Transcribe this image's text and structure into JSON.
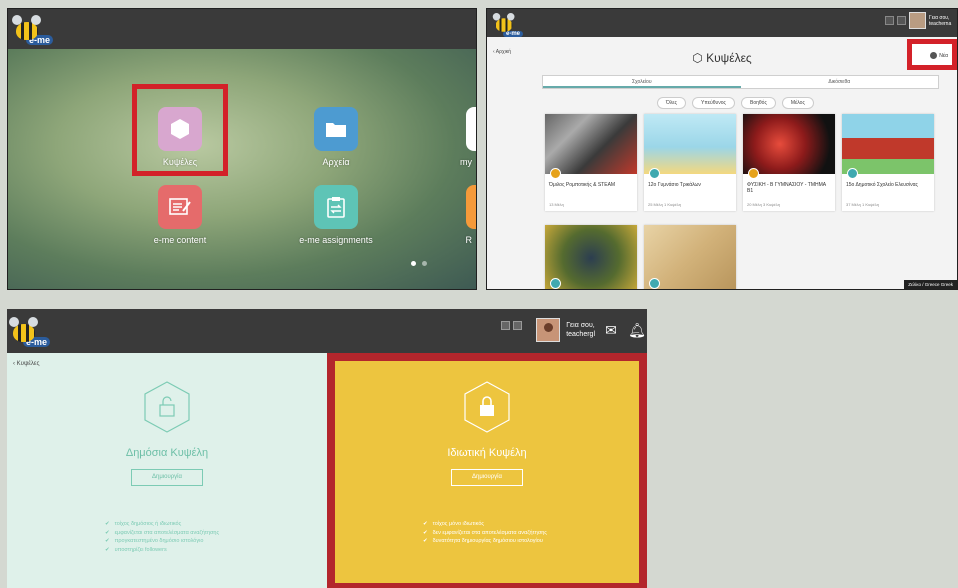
{
  "panel1": {
    "logo_text": "e-me",
    "apps": [
      {
        "label": "Κυψέλες",
        "icon": "hive-icon",
        "color": "#d8a7cf"
      },
      {
        "label": "Αρχεία",
        "icon": "folder-icon",
        "color": "#4d9bd1"
      },
      {
        "label": "my",
        "icon": "app-icon",
        "color": "#ffffff"
      },
      {
        "label": "e-me content",
        "icon": "content-editor-icon",
        "color": "#e56b6b"
      },
      {
        "label": "e-me assignments",
        "icon": "clipboard-icon",
        "color": "#5ec4b6"
      },
      {
        "label": "R",
        "icon": "app-icon",
        "color": "#f59a3a"
      }
    ]
  },
  "panel2": {
    "back_label": "Αρχική",
    "title": "Κυψέλες",
    "new_label": "Νέα",
    "tabs": [
      "Σχολείου",
      "Δικόσιεθα"
    ],
    "filters": [
      "Όλες",
      "Υπεύθυνος",
      "Βοηθός",
      "Μέλος"
    ],
    "cards": [
      {
        "title": "Όμιλος Ρομποτικής & STEAM",
        "meta": "13 Μέλη",
        "badge": "#e6a21b"
      },
      {
        "title": "12ο Γυμνάσιο Τρικάλων",
        "meta": "25 Μέλη  1 Κυψέλη",
        "badge": "#3fa9b0"
      },
      {
        "title": "ΦΥΣΙΚΗ - Β ΓΥΜΝΑΣΙΟΥ - ΤΜΗΜΑ Β1",
        "meta": "20 Μέλη  3 Κυψέλη",
        "badge": "#e6a21b"
      },
      {
        "title": "15ο Δημοτικό Σχολείο Ελευσίνας",
        "meta": "37 Μέλη  1 Κυψέλη",
        "badge": "#3fa9b0"
      },
      {
        "title": "",
        "meta": "",
        "badge": "#3fa9b0"
      },
      {
        "title": "",
        "meta": "",
        "badge": "#3fa9b0"
      }
    ],
    "user_name": "Γεια σου, teacherna",
    "language": "Ζελίκο / Greece Greek"
  },
  "panel3": {
    "back_label": "Κυψέλες",
    "user_greeting": "Γεια σου,",
    "user_name": "teachergl",
    "public": {
      "title": "Δημόσια Κυψέλη",
      "button": "Δημιουργία",
      "features": [
        "τοίχος δημόσιος ή ιδιωτικός",
        "εμφανίζεται στα αποτελέσματα αναζήτησης",
        "προγκατεστημένο δημόσιο ιστολόγιο",
        "υποστηρίζει followers"
      ]
    },
    "private": {
      "title": "Ιδιωτική Κυψέλη",
      "button": "Δημιουργία",
      "features": [
        "τοίχος μόνο ιδιωτικός",
        "δεν εμφανίζεται στα αποτελέσματα αναζήτησης",
        "δυνατότητα δημιουργίας δημόσιου ιστολογίου"
      ]
    },
    "colors": {
      "public_bg": "#dff1ea",
      "public_accent": "#56b9a1",
      "private_bg": "#edc53f",
      "highlight": "#d32129"
    }
  }
}
